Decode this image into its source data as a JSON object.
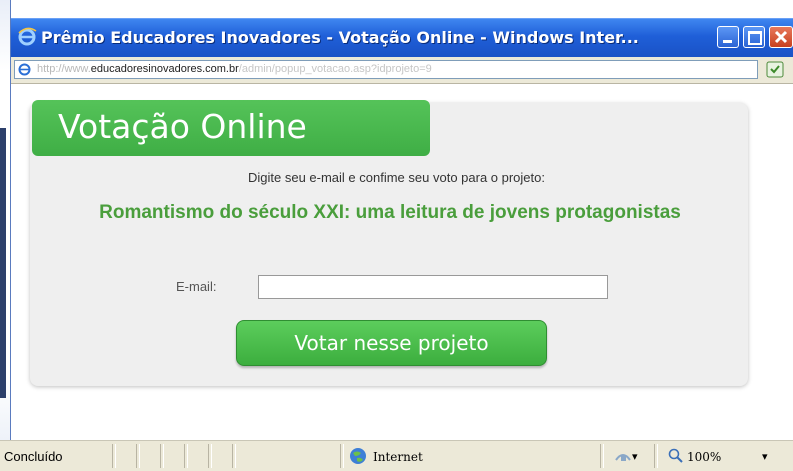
{
  "window": {
    "title": "Prêmio Educadores Inovadores - Votação Online - Windows Inter...",
    "icon": "ie-icon"
  },
  "address": {
    "url_prefix": "http://www.",
    "url_host": "educadoresinovadores.com.br",
    "url_path": "/admin/popup_votacao.asp?idprojeto=9"
  },
  "page": {
    "banner_title": "Votação Online",
    "instruction": "Digite seu e-mail e confime seu voto para o projeto:",
    "project_title": "Romantismo do século XXI: uma leitura de jovens protagonistas",
    "email_label": "E-mail:",
    "email_value": "",
    "vote_button": "Votar nesse projeto"
  },
  "status": {
    "text": "Concluído",
    "zone": "Internet",
    "zoom": "100%"
  },
  "colors": {
    "accent_green": "#4caf50",
    "project_green": "#4a9e3c",
    "titlebar_blue": "#1f5fd8"
  }
}
